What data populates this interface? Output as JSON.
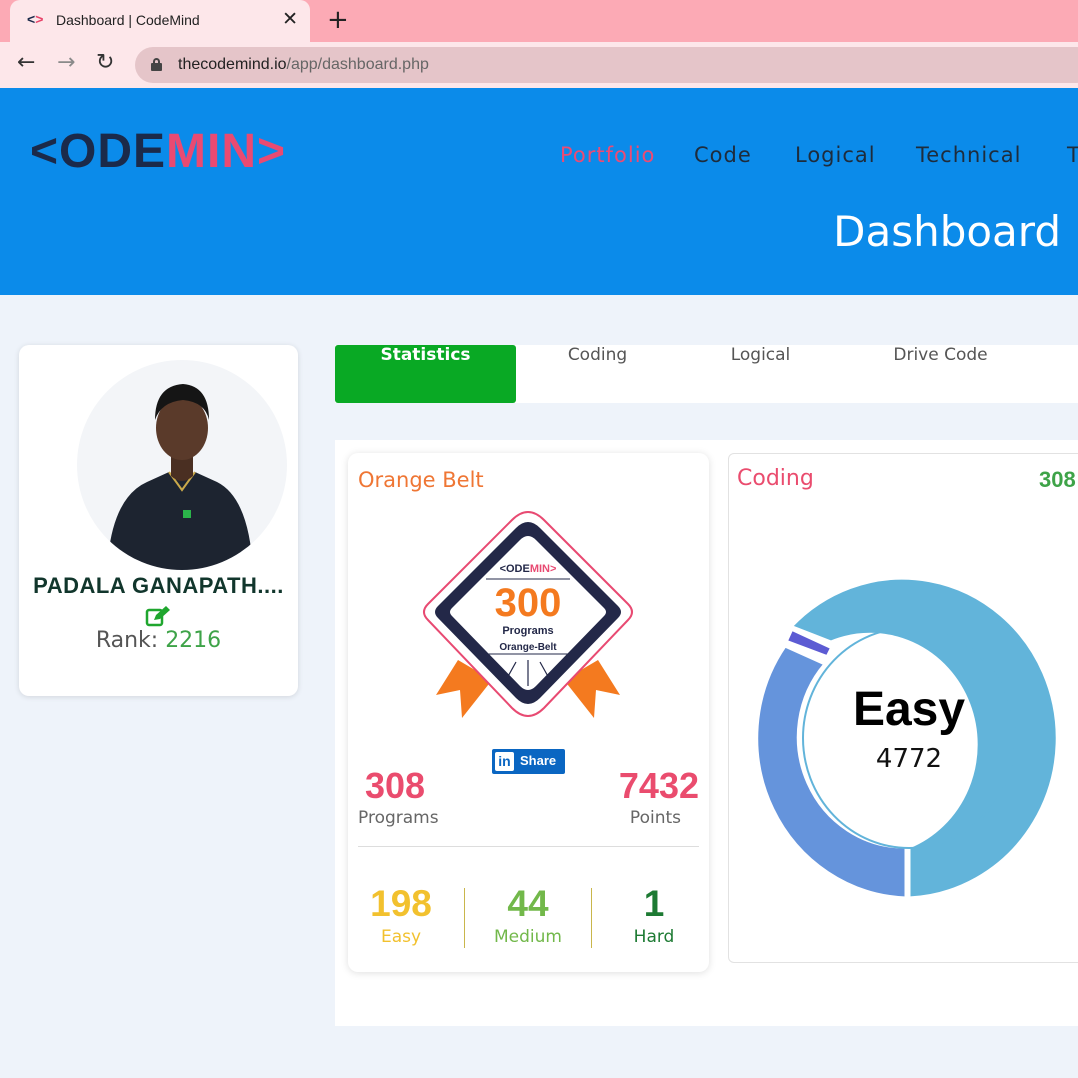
{
  "browser": {
    "tab_title": "Dashboard | CodeMind",
    "favicon_left": "<",
    "favicon_right": ">",
    "close_glyph": "✕",
    "new_tab_glyph": "+",
    "back_glyph": "←",
    "forward_glyph": "→",
    "reload_glyph": "↻",
    "url_host": "thecodemind.io",
    "url_path": "/app/dashboard.php"
  },
  "site": {
    "logo_dark_prefix": "<ODE",
    "logo_pink": "MIN",
    "logo_dark_suffix": ">",
    "nav": [
      "Portfolio",
      "Code",
      "Logical",
      "Technical",
      "T"
    ],
    "active_nav": "Portfolio",
    "page_title": "Dashboard"
  },
  "profile": {
    "name": "PADALA GANAPATH....",
    "rank_label": "Rank: ",
    "rank_value": "2216",
    "edit_icon": "edit-icon"
  },
  "tabs": [
    {
      "label": "Statistics",
      "active": true
    },
    {
      "label": "Coding",
      "active": false
    },
    {
      "label": "Logical",
      "active": false
    },
    {
      "label": "Drive Code",
      "active": false
    }
  ],
  "belt": {
    "title": "Orange Belt",
    "badge": {
      "brand_dark": "<ODE",
      "brand_pink": "MIN",
      "brand_end": ">",
      "number": "300",
      "line1": "Programs",
      "line2": "Orange-Belt"
    },
    "share_icon": "in",
    "share_label": "Share",
    "programs_value": "308",
    "programs_label": "Programs",
    "points_value": "7432",
    "points_label": "Points",
    "easy_value": "198",
    "easy_label": "Easy",
    "medium_value": "44",
    "medium_label": "Medium",
    "hard_value": "1",
    "hard_label": "Hard"
  },
  "coding": {
    "title": "Coding",
    "count": "308",
    "center_label": "Easy",
    "center_value": "4772"
  },
  "colors": {
    "header_blue": "#0b8bea",
    "accent_pink": "#ea4c6e",
    "active_tab_green": "#09a924",
    "easy": "#f2c12e",
    "medium": "#72b84a",
    "hard": "#1d7a33",
    "donut_easy": "#62b4da",
    "donut_medium": "#6594dc",
    "donut_hard": "#5c5bd3"
  }
}
